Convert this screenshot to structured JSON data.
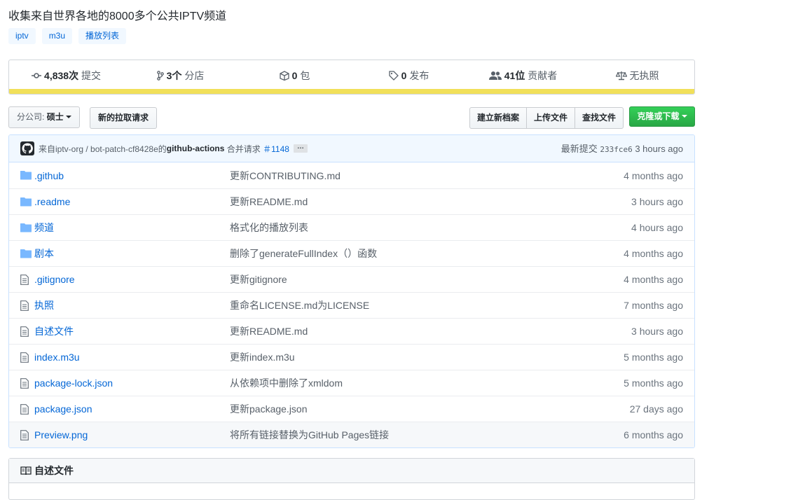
{
  "repo": {
    "description": "收集来自世界各地的8000多个公共IPTV频道",
    "topics": [
      "iptv",
      "m3u",
      "播放列表"
    ]
  },
  "stats": {
    "commits_count": "4,838次",
    "commits_label": "提交",
    "branches_count": "3个",
    "branches_label": "分店",
    "packages_count": "0",
    "packages_label": "包",
    "releases_count": "0",
    "releases_label": "发布",
    "contributors_count": "41位",
    "contributors_label": "贡献者",
    "license_label": "无执照",
    "language_color": "#f1e05a"
  },
  "toolbar": {
    "branch_prefix": "分公司:",
    "branch_name": "硕士",
    "new_pr": "新的拉取请求",
    "create_file": "建立新档案",
    "upload_files": "上传文件",
    "find_file": "查找文件",
    "clone": "克隆或下载"
  },
  "commit": {
    "message_prefix": "来自iptv-org / bot-patch-cf8428e的",
    "author": "github-actions",
    "action": "合并请求",
    "pr": "＃1148",
    "ellipsis": "…",
    "latest_label": "最新提交",
    "sha": "233fce6",
    "age": "3 hours ago"
  },
  "files": [
    {
      "type": "dir",
      "name": ".github",
      "message": "更新CONTRIBUTING.md",
      "age": "4 months ago"
    },
    {
      "type": "dir",
      "name": ".readme",
      "message": "更新README.md",
      "age": "3 hours ago"
    },
    {
      "type": "dir",
      "name": "频道",
      "message": "格式化的播放列表",
      "age": "4 hours ago"
    },
    {
      "type": "dir",
      "name": "剧本",
      "message": "删除了generateFullIndex（）函数",
      "age": "4 months ago"
    },
    {
      "type": "file",
      "name": ".gitignore",
      "message": "更新gitignore",
      "age": "4 months ago"
    },
    {
      "type": "file",
      "name": "执照",
      "message": "重命名LICENSE.md为LICENSE",
      "age": "7 months ago"
    },
    {
      "type": "file",
      "name": "自述文件",
      "message": "更新README.md",
      "age": "3 hours ago"
    },
    {
      "type": "file",
      "name": "index.m3u",
      "message": "更新index.m3u",
      "age": "5 months ago"
    },
    {
      "type": "file",
      "name": "package-lock.json",
      "message": "从依赖项中删除了xmldom",
      "age": "5 months ago"
    },
    {
      "type": "file",
      "name": "package.json",
      "message": "更新package.json",
      "age": "27 days ago"
    },
    {
      "type": "file",
      "name": "Preview.png",
      "message": "将所有链接替换为GitHub Pages链接",
      "age": "6 months ago"
    }
  ],
  "readme": {
    "title": "自述文件"
  }
}
